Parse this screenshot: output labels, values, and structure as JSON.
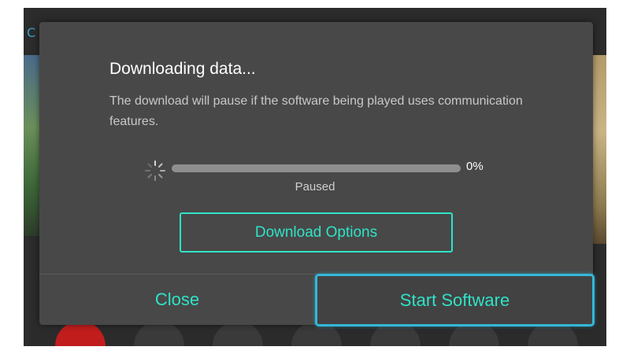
{
  "dialog": {
    "title": "Downloading data...",
    "description": "The download will pause if the software being played uses communication features.",
    "progress": {
      "percent_label": "0%",
      "fraction": 0,
      "status": "Paused"
    },
    "options_button": "Download Options",
    "close_button": "Close",
    "start_button": "Start Software"
  },
  "colors": {
    "accent": "#2fe3c7",
    "focus_border": "#35b7d7",
    "dialog_bg": "#484848",
    "screen_bg": "#2b2b2b",
    "home_button_red": "#c11d1d"
  },
  "icons": {
    "spinner": "loading-spinner-icon"
  }
}
